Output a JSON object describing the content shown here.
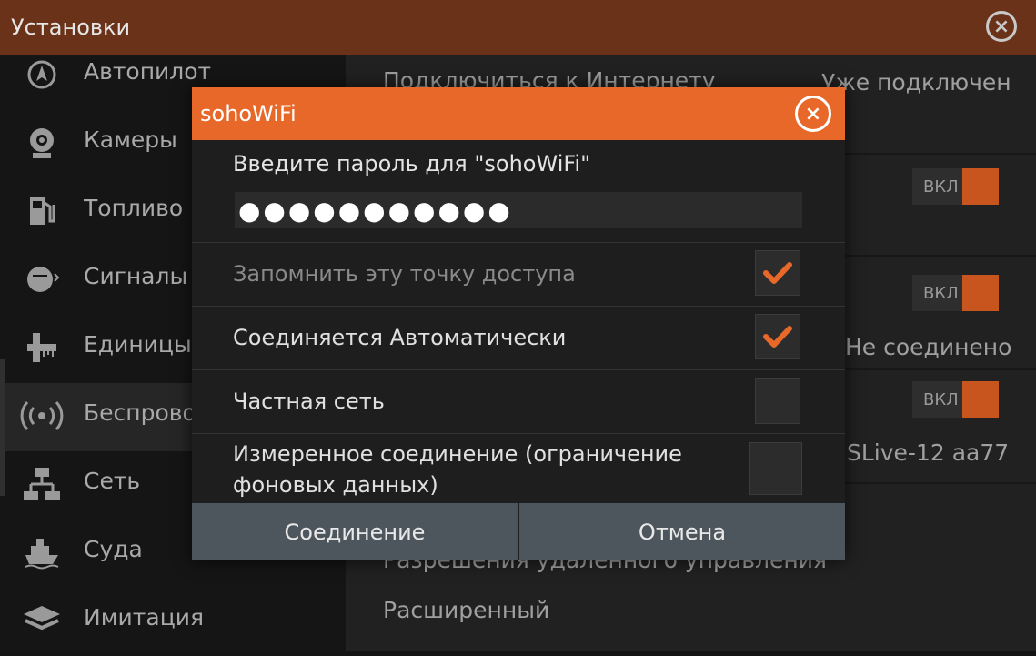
{
  "window": {
    "title": "Установки",
    "close_glyph": "×"
  },
  "sidebar": {
    "items": [
      {
        "label": "Автопилот",
        "icon": "autopilot-icon",
        "glyph": "➤"
      },
      {
        "label": "Камеры",
        "icon": "camera-icon",
        "glyph": "◉"
      },
      {
        "label": "Топливо",
        "icon": "fuel-pump-icon",
        "glyph": "⛽"
      },
      {
        "label": "Сигналы",
        "icon": "alarm-bell-icon",
        "glyph": "●"
      },
      {
        "label": "Единицы",
        "icon": "ruler-icon",
        "glyph": "╟"
      },
      {
        "label": "Беспровод",
        "icon": "wireless-icon",
        "glyph": "((•))"
      },
      {
        "label": "Сеть",
        "icon": "network-icon",
        "glyph": "⊶"
      },
      {
        "label": "Суда",
        "icon": "vessel-icon",
        "glyph": "⛴"
      },
      {
        "label": "Имитация",
        "icon": "layers-icon",
        "glyph": "◆"
      }
    ],
    "active_index": 5
  },
  "background": {
    "connect_internet_label": "Подключиться к Интернету",
    "connect_internet_status": "Уже подключен",
    "status_not_connected": "Не соединено",
    "device_name": "SLive-12 aa77",
    "remote_control_label": "Разрешения удаленного управления",
    "advanced_label": "Расширенный",
    "toggle_label": "ВКЛ",
    "accent_color": "#c8541e"
  },
  "dialog": {
    "title": "sohoWiFi",
    "close_glyph": "×",
    "prompt": "Введите пароль для \"sohoWiFi\"",
    "password_value": "●●●●●●●●●●●",
    "options": [
      {
        "label": "Запомнить эту точку доступа",
        "checked": true,
        "dimmed": true
      },
      {
        "label": "Соединяется Автоматически",
        "checked": true,
        "dimmed": false
      },
      {
        "label": "Частная сеть",
        "checked": false,
        "dimmed": false
      },
      {
        "label_line1": "Измеренное соединение (ограничение",
        "label_line2": "фоновых данных)",
        "checked": false,
        "dimmed": false
      }
    ],
    "connect_button": "Соединение",
    "cancel_button": "Отмена",
    "header_color": "#e8682a",
    "check_color": "#e8682a"
  }
}
